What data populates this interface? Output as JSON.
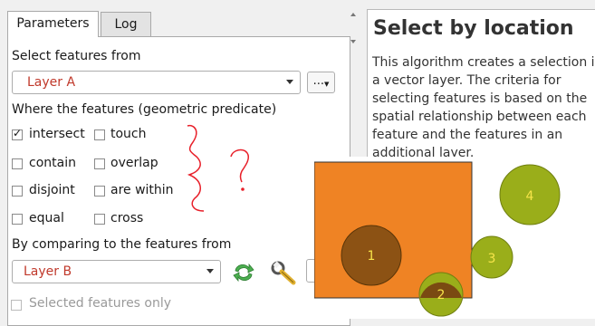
{
  "tabs": [
    {
      "label": "Parameters",
      "active": true
    },
    {
      "label": "Log",
      "active": false
    }
  ],
  "select_from": {
    "label": "Select features from",
    "value": "Layer A",
    "browse_label": "..."
  },
  "predicate": {
    "label": "Where the features (geometric predicate)",
    "options": [
      {
        "label": "intersect",
        "checked": true
      },
      {
        "label": "touch",
        "checked": false
      },
      {
        "label": "contain",
        "checked": false
      },
      {
        "label": "overlap",
        "checked": false
      },
      {
        "label": "disjoint",
        "checked": false
      },
      {
        "label": "are within",
        "checked": false
      },
      {
        "label": "equal",
        "checked": false
      },
      {
        "label": "cross",
        "checked": false
      }
    ]
  },
  "compare": {
    "label": "By comparing to the features from",
    "value": "Layer B",
    "icons": [
      "iterate-icon",
      "wrench-icon"
    ]
  },
  "cut_off_row": {
    "label": "Selected features only"
  },
  "help": {
    "title": "Select by location",
    "lines": [
      "This algorithm creates a selection i",
      "a vector layer. The criteria for",
      "selecting features is based on the",
      "spatial relationship between each",
      "feature and the features in an",
      "additional layer."
    ]
  },
  "diagram": {
    "circles": [
      {
        "label": "1"
      },
      {
        "label": "2"
      },
      {
        "label": "3"
      },
      {
        "label": "4"
      }
    ]
  },
  "colors": {
    "accent_red": "#c0392b",
    "square_orange": "#ef8324",
    "circle_olive": "#9aae1a",
    "circle_dark": "#7a4a12",
    "annotation_red": "#e8202a"
  }
}
